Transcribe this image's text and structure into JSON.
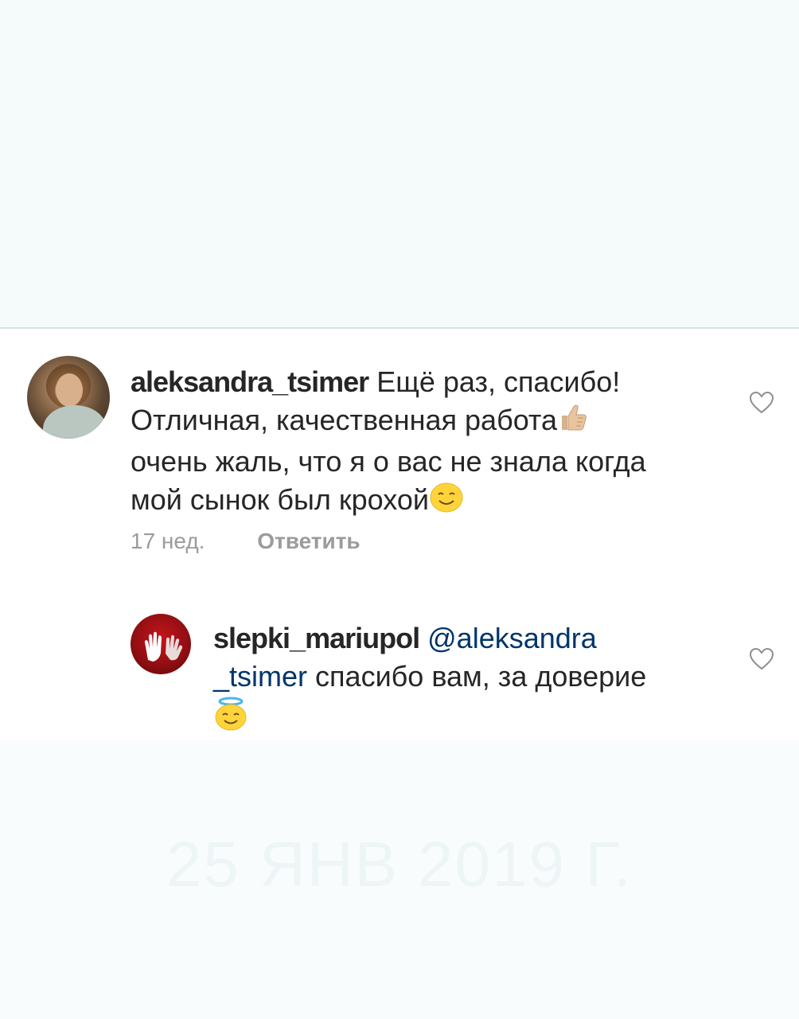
{
  "comments": [
    {
      "username": "aleksandra_tsimer",
      "text_line1": "Ещё раз, спасибо!",
      "text_line2": "Отличная, качественная работа",
      "text_line3": "очень жаль, что я о вас не знала когда",
      "text_line4": "мой сынок был крохой",
      "emoji_1": "thumbs-up-icon",
      "emoji_2": "smiling-face-icon",
      "time": "17 нед.",
      "reply_label": "Ответить"
    },
    {
      "username": "slepki_mariupol",
      "mention_part1": "@aleksandra",
      "mention_part2": "_tsimer",
      "text": "спасибо вам, за доверие",
      "emoji": "angel-face-icon"
    }
  ],
  "caption": "25 ЯНВ 2019 Г.",
  "colors": {
    "text": "#262626",
    "meta": "#8e8e8e",
    "mention": "#003569",
    "divider": "#d3e0e6",
    "background": "#f7fbfc"
  }
}
